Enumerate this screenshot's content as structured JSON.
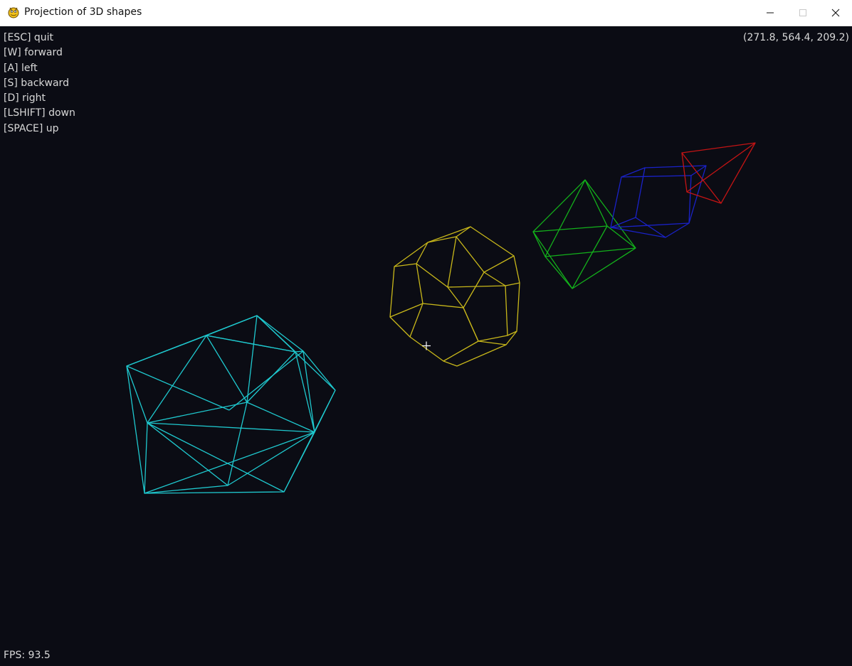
{
  "window": {
    "title": "Projection of 3D shapes",
    "app_icon": "pygame-snake-icon",
    "buttons": {
      "minimize_icon": "minimize-icon",
      "maximize_icon": "maximize-icon",
      "close_icon": "close-icon"
    }
  },
  "hud": {
    "controls": [
      "[ESC] quit",
      "[W] forward",
      "[A] left",
      "[S] backward",
      "[D] right",
      "[LSHIFT] down",
      "[SPACE] up"
    ],
    "camera_position": "(271.8, 564.4, 209.2)",
    "fps": "FPS: 93.5"
  },
  "scene": {
    "background_color": "#0b0c14",
    "shapes": [
      {
        "name": "icosahedron",
        "color": "#1fc9cf"
      },
      {
        "name": "dodecahedron",
        "color": "#c9b81a"
      },
      {
        "name": "octahedron",
        "color": "#13b11b"
      },
      {
        "name": "cube",
        "color": "#1a22c9"
      },
      {
        "name": "tetrahedron",
        "color": "#c41414"
      }
    ],
    "crosshair_icon": "crosshair-icon"
  }
}
